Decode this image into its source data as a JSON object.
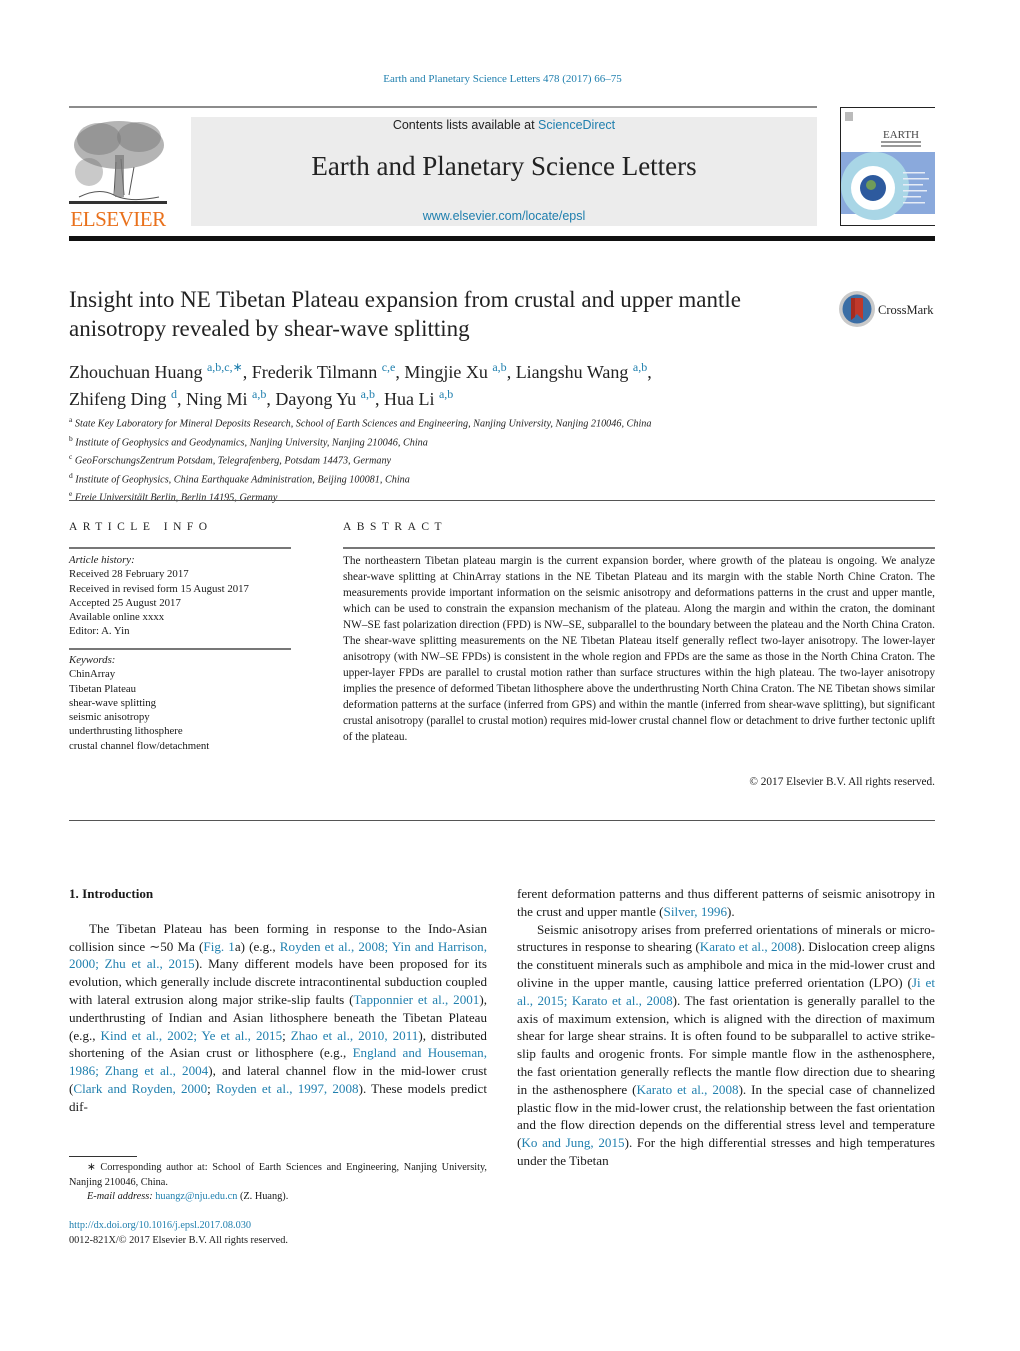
{
  "header": {
    "citation": "Earth and Planetary Science Letters 478 (2017) 66–75",
    "contents_prefix": "Contents lists available at ",
    "contents_link": "ScienceDirect",
    "journal_title": "Earth and Planetary Science Letters",
    "journal_url": "www.elsevier.com/locate/epsl",
    "publisher_logo_text": "ELSEVIER",
    "cover_title": "EARTH",
    "cover_subtitle": "& PLANETARY SCIENCE LETTERS"
  },
  "article": {
    "title": "Insight into NE Tibetan Plateau expansion from crustal and upper mantle anisotropy revealed by shear-wave splitting",
    "crossmark_label": "CrossMark",
    "authors": [
      {
        "name": "Zhouchuan Huang",
        "aff": "a,b,c,∗",
        "sep": ", "
      },
      {
        "name": "Frederik Tilmann",
        "aff": "c,e",
        "sep": ", "
      },
      {
        "name": "Mingjie Xu",
        "aff": "a,b",
        "sep": ", "
      },
      {
        "name": "Liangshu Wang",
        "aff": "a,b",
        "sep": ","
      },
      {
        "name": "Zhifeng Ding",
        "aff": "d",
        "sep": ", "
      },
      {
        "name": "Ning Mi",
        "aff": "a,b",
        "sep": ", "
      },
      {
        "name": "Dayong Yu",
        "aff": "a,b",
        "sep": ", "
      },
      {
        "name": "Hua Li",
        "aff": "a,b",
        "sep": ""
      }
    ],
    "affiliations": [
      {
        "key": "a",
        "text": "State Key Laboratory for Mineral Deposits Research, School of Earth Sciences and Engineering, Nanjing University, Nanjing 210046, China"
      },
      {
        "key": "b",
        "text": "Institute of Geophysics and Geodynamics, Nanjing University, Nanjing 210046, China"
      },
      {
        "key": "c",
        "text": "GeoForschungsZentrum Potsdam, Telegrafenberg, Potsdam 14473, Germany"
      },
      {
        "key": "d",
        "text": "Institute of Geophysics, China Earthquake Administration, Beijing 100081, China"
      },
      {
        "key": "e",
        "text": "Freie Universitält Berlin, Berlin 14195, Germany"
      }
    ]
  },
  "article_info": {
    "heading": "ARTICLE INFO",
    "history_label": "Article history:",
    "history": [
      "Received 28 February 2017",
      "Received in revised form 15 August 2017",
      "Accepted 25 August 2017",
      "Available online xxxx",
      "Editor: A. Yin"
    ],
    "keywords_label": "Keywords:",
    "keywords": [
      "ChinArray",
      "Tibetan Plateau",
      "shear-wave splitting",
      "seismic anisotropy",
      "underthrusting lithosphere",
      "crustal channel flow/detachment"
    ]
  },
  "abstract": {
    "heading": "ABSTRACT",
    "text": "The northeastern Tibetan plateau margin is the current expansion border, where growth of the plateau is ongoing. We analyze shear-wave splitting at ChinArray stations in the NE Tibetan Plateau and its margin with the stable North Chine Craton. The measurements provide important information on the seismic anisotropy and deformations patterns in the crust and upper mantle, which can be used to constrain the expansion mechanism of the plateau. Along the margin and within the craton, the dominant NW–SE fast polarization direction (FPD) is NW–SE, subparallel to the boundary between the plateau and the North China Craton. The shear-wave splitting measurements on the NE Tibetan Plateau itself generally reflect two-layer anisotropy. The lower-layer anisotropy (with NW–SE FPDs) is consistent in the whole region and FPDs are the same as those in the North China Craton. The upper-layer FPDs are parallel to crustal motion rather than surface structures within the high plateau. The two-layer anisotropy implies the presence of deformed Tibetan lithosphere above the underthrusting North China Craton. The NE Tibetan shows similar deformation patterns at the surface (inferred from GPS) and within the mantle (inferred from shear-wave splitting), but significant crustal anisotropy (parallel to crustal motion) requires mid-lower crustal channel flow or detachment to drive further tectonic uplift of the plateau.",
    "copyright": "© 2017 Elsevier B.V. All rights reserved."
  },
  "body": {
    "section_heading": "1. Introduction",
    "left_column": [
      {
        "t": "The Tibetan Plateau has been forming in response to the Indo-Asian collision since ∼50 Ma ("
      },
      {
        "t": "Fig. 1",
        "link": true
      },
      {
        "t": "a) (e.g., "
      },
      {
        "t": "Royden et al., 2008; Yin and Harrison, 2000; Zhu et al., 2015",
        "link": true
      },
      {
        "t": "). Many different models have been proposed for its evolution, which generally include discrete intracontinental subduction coupled with lateral extrusion along major strike-slip faults ("
      },
      {
        "t": "Tapponnier et al., 2001",
        "link": true
      },
      {
        "t": "), underthrusting of Indian and Asian lithosphere beneath the Tibetan Plateau (e.g., "
      },
      {
        "t": "Kind et al., 2002; Ye et al., 2015",
        "link": true
      },
      {
        "t": "; "
      },
      {
        "t": "Zhao et al., 2010, 2011",
        "link": true
      },
      {
        "t": "), distributed shortening of the Asian crust or lithosphere (e.g., "
      },
      {
        "t": "England and Houseman, 1986; Zhang et al., 2004",
        "link": true
      },
      {
        "t": "), and lateral channel flow in the mid-lower crust ("
      },
      {
        "t": "Clark and Royden, 2000",
        "link": true
      },
      {
        "t": "; "
      },
      {
        "t": "Royden et al., 1997, 2008",
        "link": true
      },
      {
        "t": "). These models predict dif-"
      }
    ],
    "right_column_p1": [
      {
        "t": "ferent deformation patterns and thus different patterns of seismic anisotropy in the crust and upper mantle ("
      },
      {
        "t": "Silver, 1996",
        "link": true
      },
      {
        "t": ")."
      }
    ],
    "right_column_p2": [
      {
        "t": "Seismic anisotropy arises from preferred orientations of minerals or micro-structures in response to shearing ("
      },
      {
        "t": "Karato et al., 2008",
        "link": true
      },
      {
        "t": "). Dislocation creep aligns the constituent minerals such as amphibole and mica in the mid-lower crust and olivine in the upper mantle, causing lattice preferred orientation (LPO) ("
      },
      {
        "t": "Ji et al., 2015; Karato et al., 2008",
        "link": true
      },
      {
        "t": "). The fast orientation is generally parallel to the axis of maximum extension, which is aligned with the direction of maximum shear for large shear strains. It is often found to be subparallel to active strike-slip faults and orogenic fronts. For simple mantle flow in the asthenosphere, the fast orientation generally reflects the mantle flow direction due to shearing in the asthenosphere ("
      },
      {
        "t": "Karato et al., 2008",
        "link": true
      },
      {
        "t": "). In the special case of channelized plastic flow in the mid-lower crust, the relationship between the fast orientation and the flow direction depends on the differential stress level and temperature ("
      },
      {
        "t": "Ko and Jung, 2015",
        "link": true
      },
      {
        "t": "). For the high differential stresses and high temperatures under the Tibetan"
      }
    ]
  },
  "footnote": {
    "marker": "∗",
    "corresponding": "Corresponding author at: School of Earth Sciences and Engineering, Nanjing University, Nanjing 210046, China.",
    "email_label": "E-mail address:",
    "email": "huangz@nju.edu.cn",
    "email_suffix": " (Z. Huang).",
    "doi": "http://dx.doi.org/10.1016/j.epsl.2017.08.030",
    "issn_copyright": "0012-821X/© 2017 Elsevier B.V. All rights reserved."
  },
  "colors": {
    "link": "#1f7fae",
    "elsevier_orange": "#e9711c",
    "masthead_bg": "#ececec"
  }
}
